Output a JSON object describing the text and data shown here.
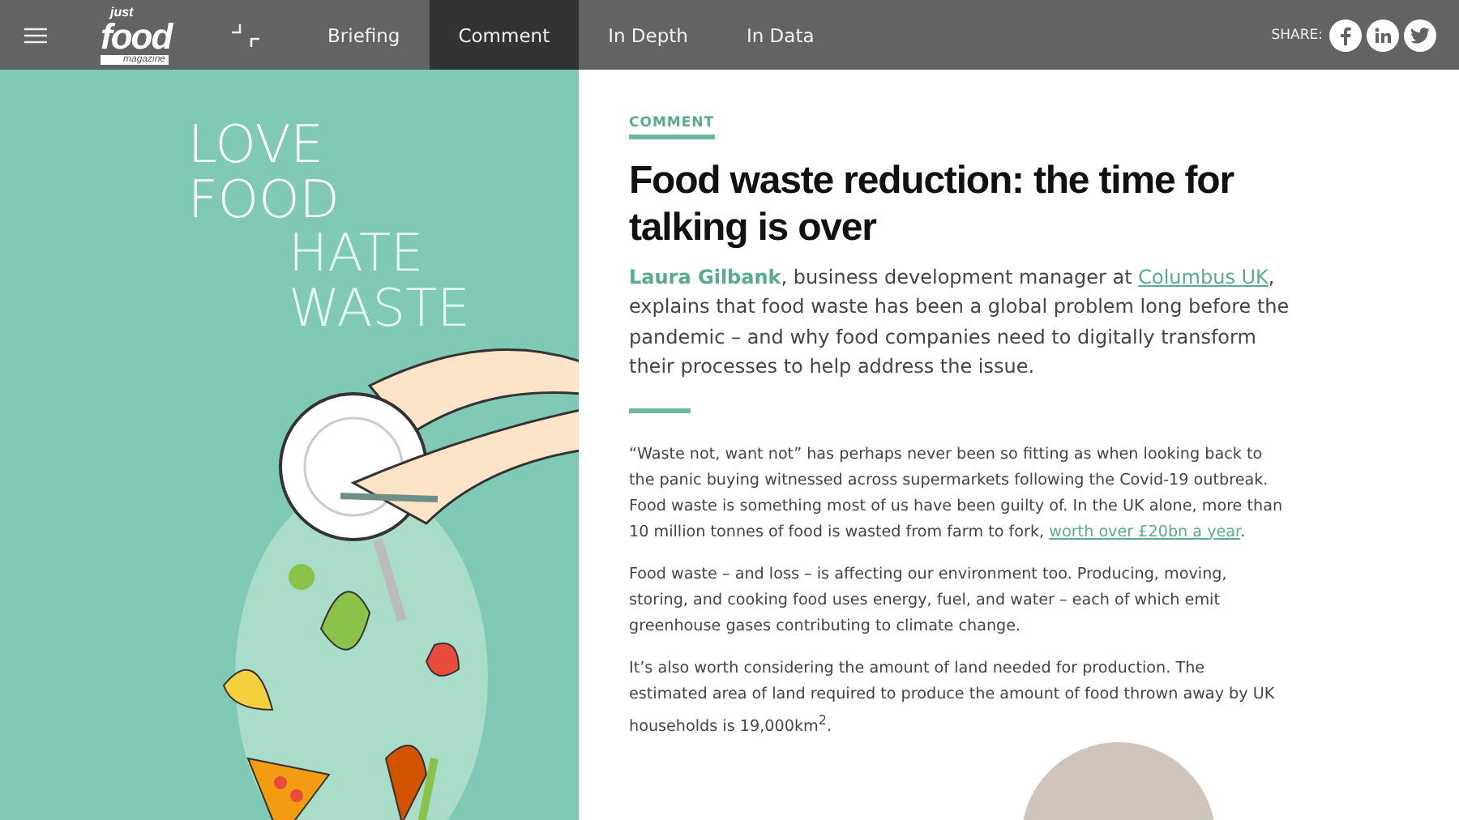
{
  "nav": {
    "logo": {
      "top": "just",
      "main": "food",
      "bottom": "magazine"
    },
    "tabs": [
      {
        "label": "Briefing",
        "selected": false
      },
      {
        "label": "Comment",
        "selected": true
      },
      {
        "label": "In Depth",
        "selected": false
      },
      {
        "label": "In Data",
        "selected": false
      }
    ],
    "share_label": "SHARE:"
  },
  "illustration": {
    "words": [
      "LOVE",
      "FOOD",
      "HATE",
      "WASTE"
    ]
  },
  "article": {
    "category": "COMMENT",
    "title": "Food waste reduction: the time for talking is over",
    "standfirst": [
      {
        "kind": "author",
        "text": "Laura Gilbank"
      },
      {
        "kind": "text",
        "text": ", business development manager at "
      },
      {
        "kind": "link",
        "text": "Columbus UK"
      },
      {
        "kind": "text",
        "text": ", explains that food waste has been a global problem long before the pandemic – and why food companies need to digitally transform their processes to help address the issue."
      }
    ],
    "paragraphs": [
      [
        {
          "kind": "text",
          "text": "“Waste not, want not” has perhaps never been so fitting as when looking back to the panic buying witnessed across supermarkets following the Covid-19 outbreak. Food waste is something most of us have been guilty of. In the UK alone, more than 10 million tonnes of food is wasted from farm to fork, "
        },
        {
          "kind": "link",
          "text": "worth over £20bn a year"
        },
        {
          "kind": "text",
          "text": "."
        }
      ],
      [
        {
          "kind": "text",
          "text": "Food waste – and loss – is affecting our environment too. Producing, moving, storing, and cooking food uses energy, fuel, and water – each of which emit greenhouse gases contributing to climate change."
        }
      ],
      [
        {
          "kind": "text",
          "text": "It’s also worth considering the amount of land needed for production. The estimated area of land required to produce the amount of food thrown away by UK households is 19,000km$^{2}$."
        }
      ]
    ]
  }
}
